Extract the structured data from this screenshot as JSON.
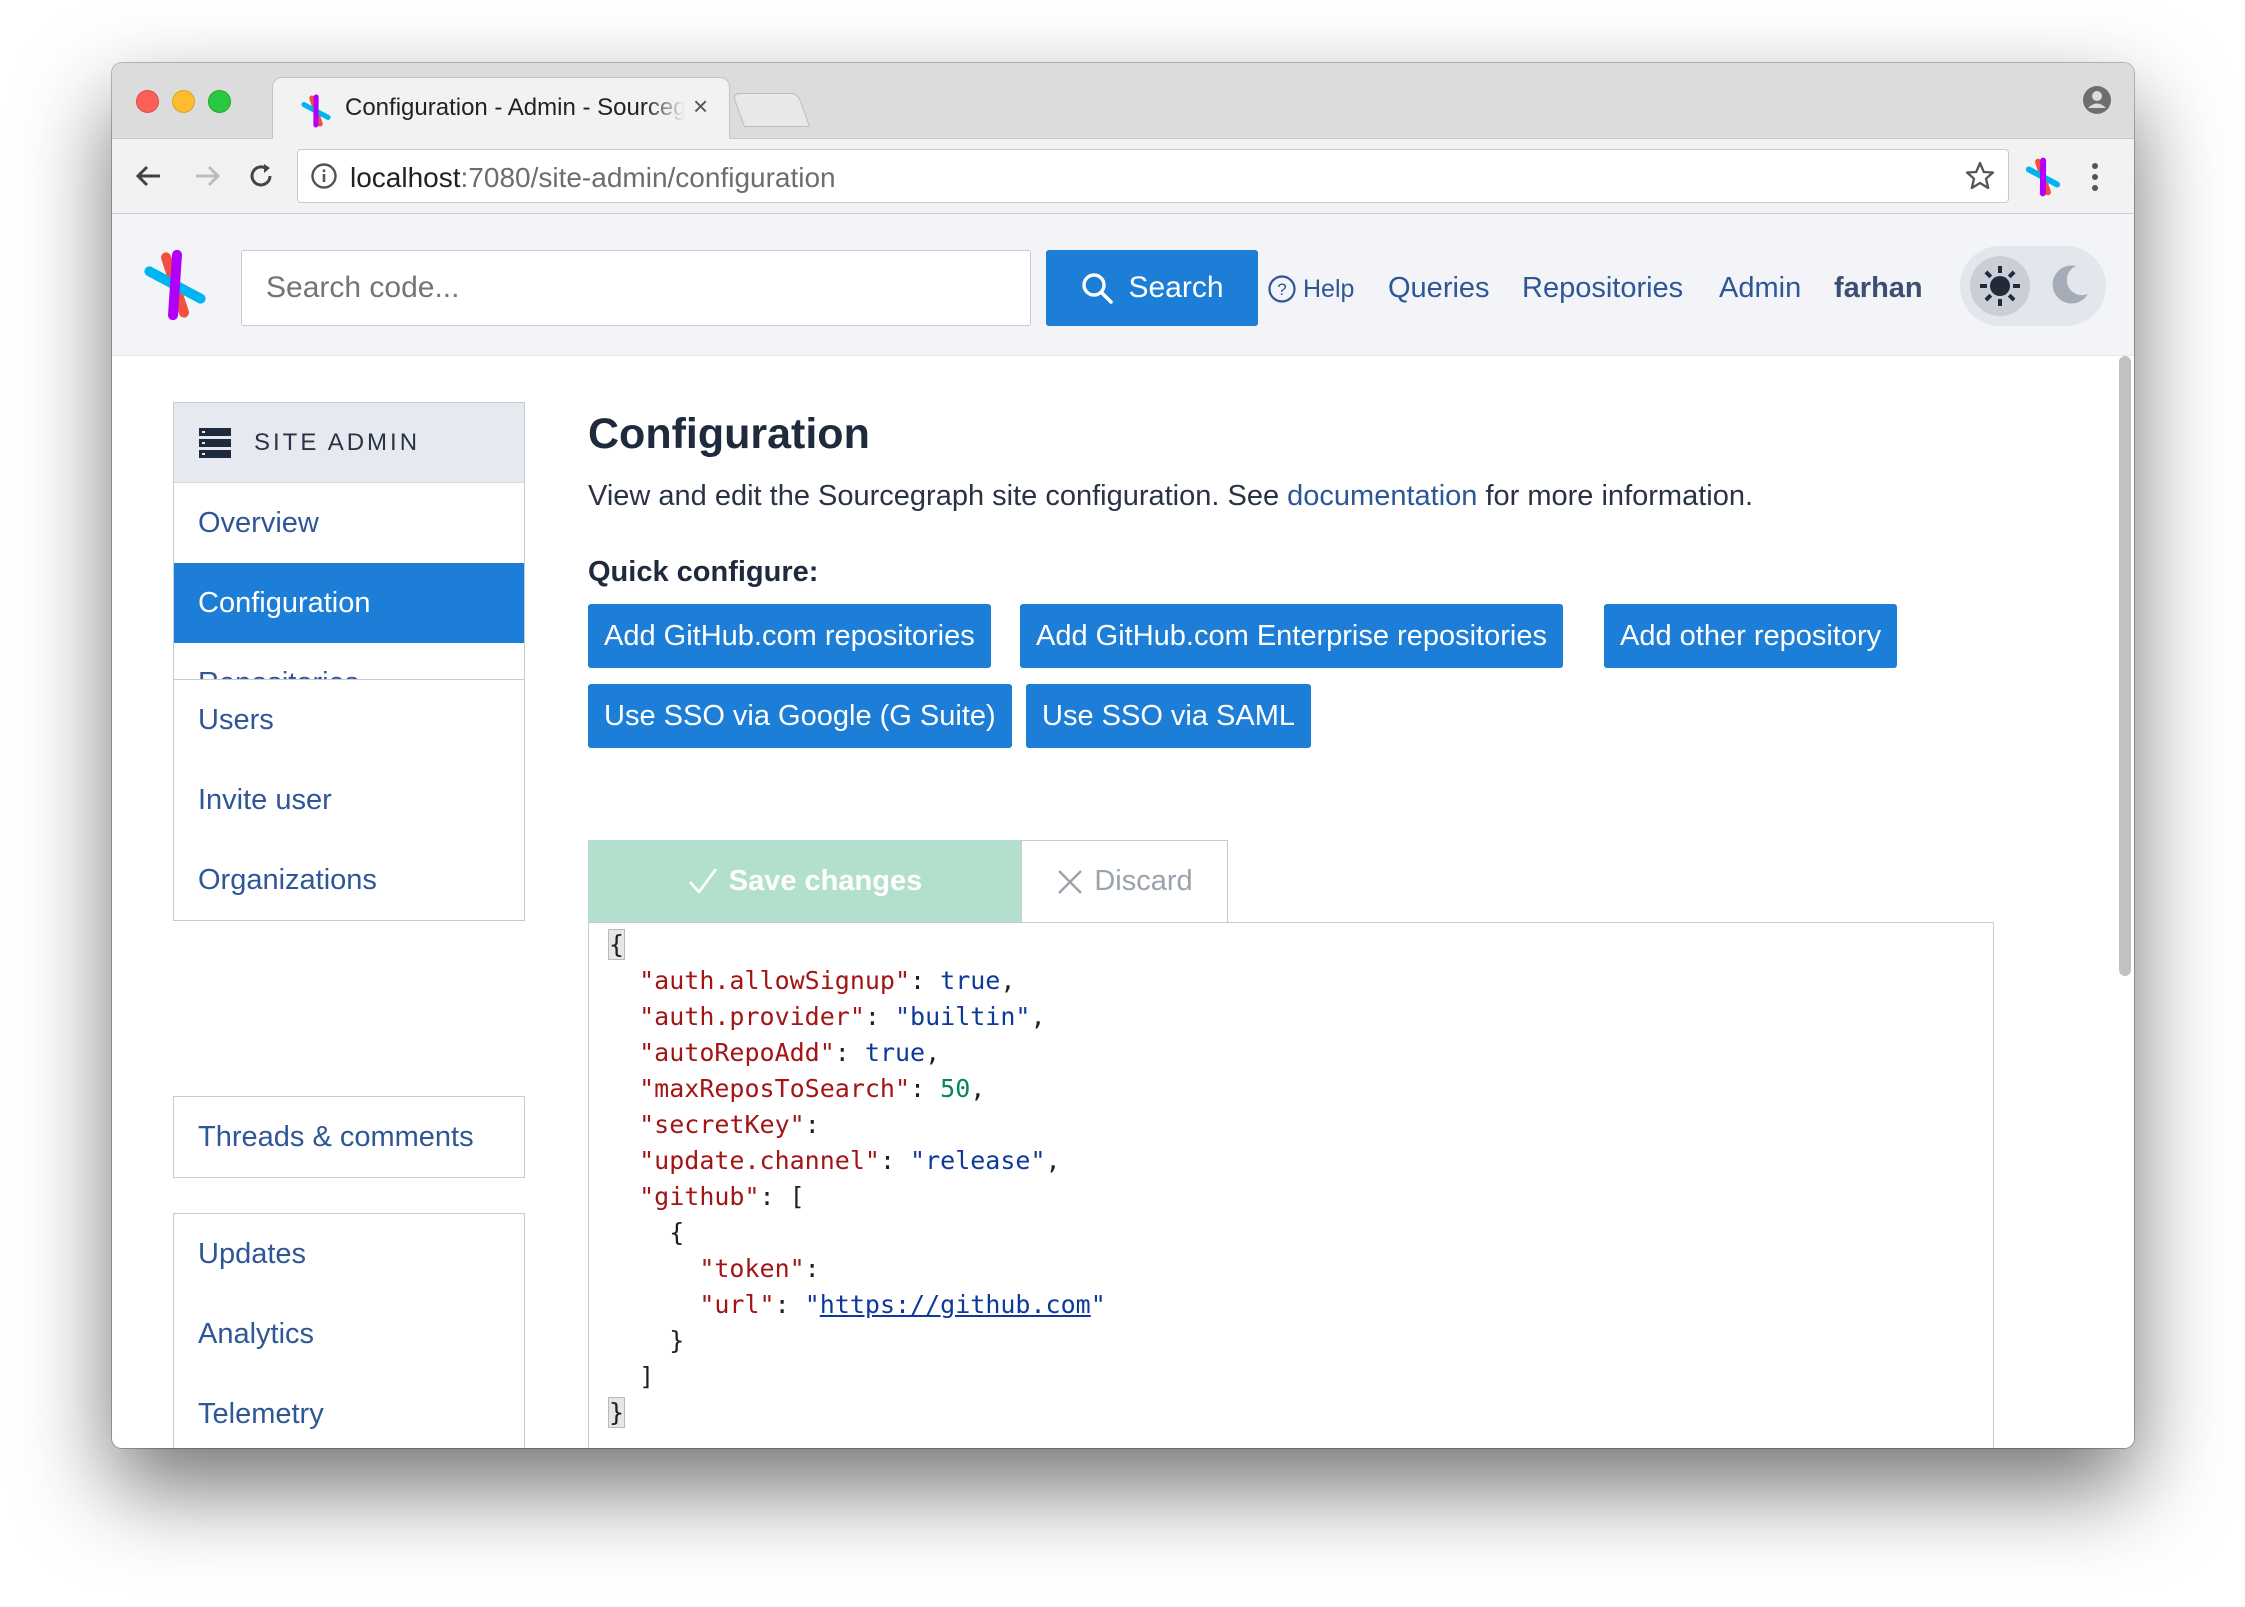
{
  "browser": {
    "tab_title": "Configuration - Admin - Sourcegraph",
    "tab_close": "×",
    "url_host": "localhost",
    "url_path": ":7080/site-admin/configuration"
  },
  "header": {
    "search_placeholder": "Search code...",
    "search_label": "Search",
    "help_label": "Help",
    "nav": {
      "queries": "Queries",
      "repositories": "Repositories",
      "admin": "Admin",
      "user": "farhan"
    }
  },
  "sidebar": {
    "header": "SITE ADMIN",
    "group1": [
      "Overview",
      "Configuration",
      "Repositories"
    ],
    "group2": [
      "Users",
      "Invite user",
      "Organizations"
    ],
    "group3": [
      "Threads & comments"
    ],
    "group4": [
      "Updates",
      "Analytics",
      "Telemetry"
    ],
    "active": "Configuration"
  },
  "main": {
    "title": "Configuration",
    "desc_before": "View and edit the Sourcegraph site configuration. See ",
    "desc_link": "documentation",
    "desc_after": " for more information.",
    "quick_label": "Quick configure:",
    "quick_buttons": [
      "Add GitHub.com repositories",
      "Add GitHub.com Enterprise repositories",
      "Add other repository",
      "Use SSO via Google (G Suite)",
      "Use SSO via SAML"
    ],
    "save_label": "Save changes",
    "discard_label": "Discard"
  },
  "config": {
    "open_brace": "{",
    "close_brace": "}",
    "allowSignup_key": "\"auth.allowSignup\"",
    "allowSignup_val": "true",
    "provider_key": "\"auth.provider\"",
    "provider_val": "\"builtin\"",
    "autoRepoAdd_key": "\"autoRepoAdd\"",
    "autoRepoAdd_val": "true",
    "maxRepos_key": "\"maxReposToSearch\"",
    "maxRepos_val": "50",
    "secretKey_key": "\"secretKey\"",
    "channel_key": "\"update.channel\"",
    "channel_val": "\"release\"",
    "github_key": "\"github\"",
    "token_key": "\"token\"",
    "url_key": "\"url\"",
    "url_val": "https://github.com"
  },
  "colors": {
    "primary": "#1c7ed6",
    "link": "#2f5696",
    "success_disabled": "#b3e0cc"
  }
}
